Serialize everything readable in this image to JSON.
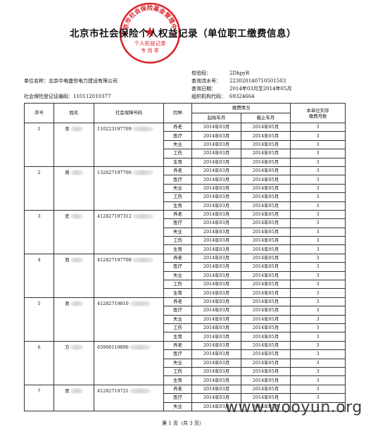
{
  "title": "北京市社会保险个人权益记录（单位职工缴费信息）",
  "seal": {
    "text_arc": "北京市社会保险基金管理中心",
    "text_line1": "个人权益记录",
    "text_line2": "专 用 章",
    "color": "#d9262b"
  },
  "meta": {
    "check_code_label": "校验码：",
    "check_code": "2DhpyR",
    "serial_label": "查询流水号：",
    "serial": "223020140710501503",
    "query_date_label": "查询日期：",
    "query_date": "2014年03月至2014年05月",
    "org_code_label": "组织机构代码：",
    "org_code": "69324664",
    "company_label": "单位名称：",
    "company": "北京中电盛世电力建设有限公司",
    "reg_label": "社会保险登记证编码：",
    "reg_code": "110112010377"
  },
  "table": {
    "headers": {
      "seq": "序号",
      "name": "姓名",
      "ssn": "社会保障号码",
      "type": "险种",
      "status": "缴费情况",
      "start": "起始年月",
      "end": "截止年月",
      "months_l1": "本单位实际",
      "months_l2": "缴费月数"
    },
    "insurance_types": [
      "养老",
      "医疗",
      "失业",
      "工伤",
      "生育"
    ],
    "persons": [
      {
        "seq": "1",
        "name": "李",
        "ssn": "110223197709",
        "start": "2014年03月",
        "end": "2014年05月",
        "months": "3",
        "rows": 5
      },
      {
        "seq": "2",
        "name": "周",
        "ssn": "132627197700",
        "start": "2014年03月",
        "end": "2014年05月",
        "months": "3",
        "rows": 5
      },
      {
        "seq": "3",
        "name": "史",
        "ssn": "412827197312",
        "start": "2014年03月",
        "end": "2014年05月",
        "months": "3",
        "rows": 5
      },
      {
        "seq": "4",
        "name": "贾",
        "ssn": "412827197708",
        "start": "2014年03月",
        "end": "2014年05月",
        "months": "3",
        "rows": 5
      },
      {
        "seq": "5",
        "name": "贾",
        "ssn": "41282719810",
        "start": "2014年03月",
        "end": "2014年05月",
        "months": "3",
        "rows": 5
      },
      {
        "seq": "6",
        "name": "方",
        "ssn": "65900119890",
        "start": "2014年03月",
        "end": "2014年05月",
        "months": "3",
        "rows": 5
      },
      {
        "seq": "7",
        "name": "贾",
        "ssn": "41282719721",
        "start": "2014年03月",
        "end": "2014年05月",
        "months": "3",
        "rows": 3
      }
    ]
  },
  "footer": "第 1 页（共 3 页）",
  "watermark": "www.wooyun.org"
}
